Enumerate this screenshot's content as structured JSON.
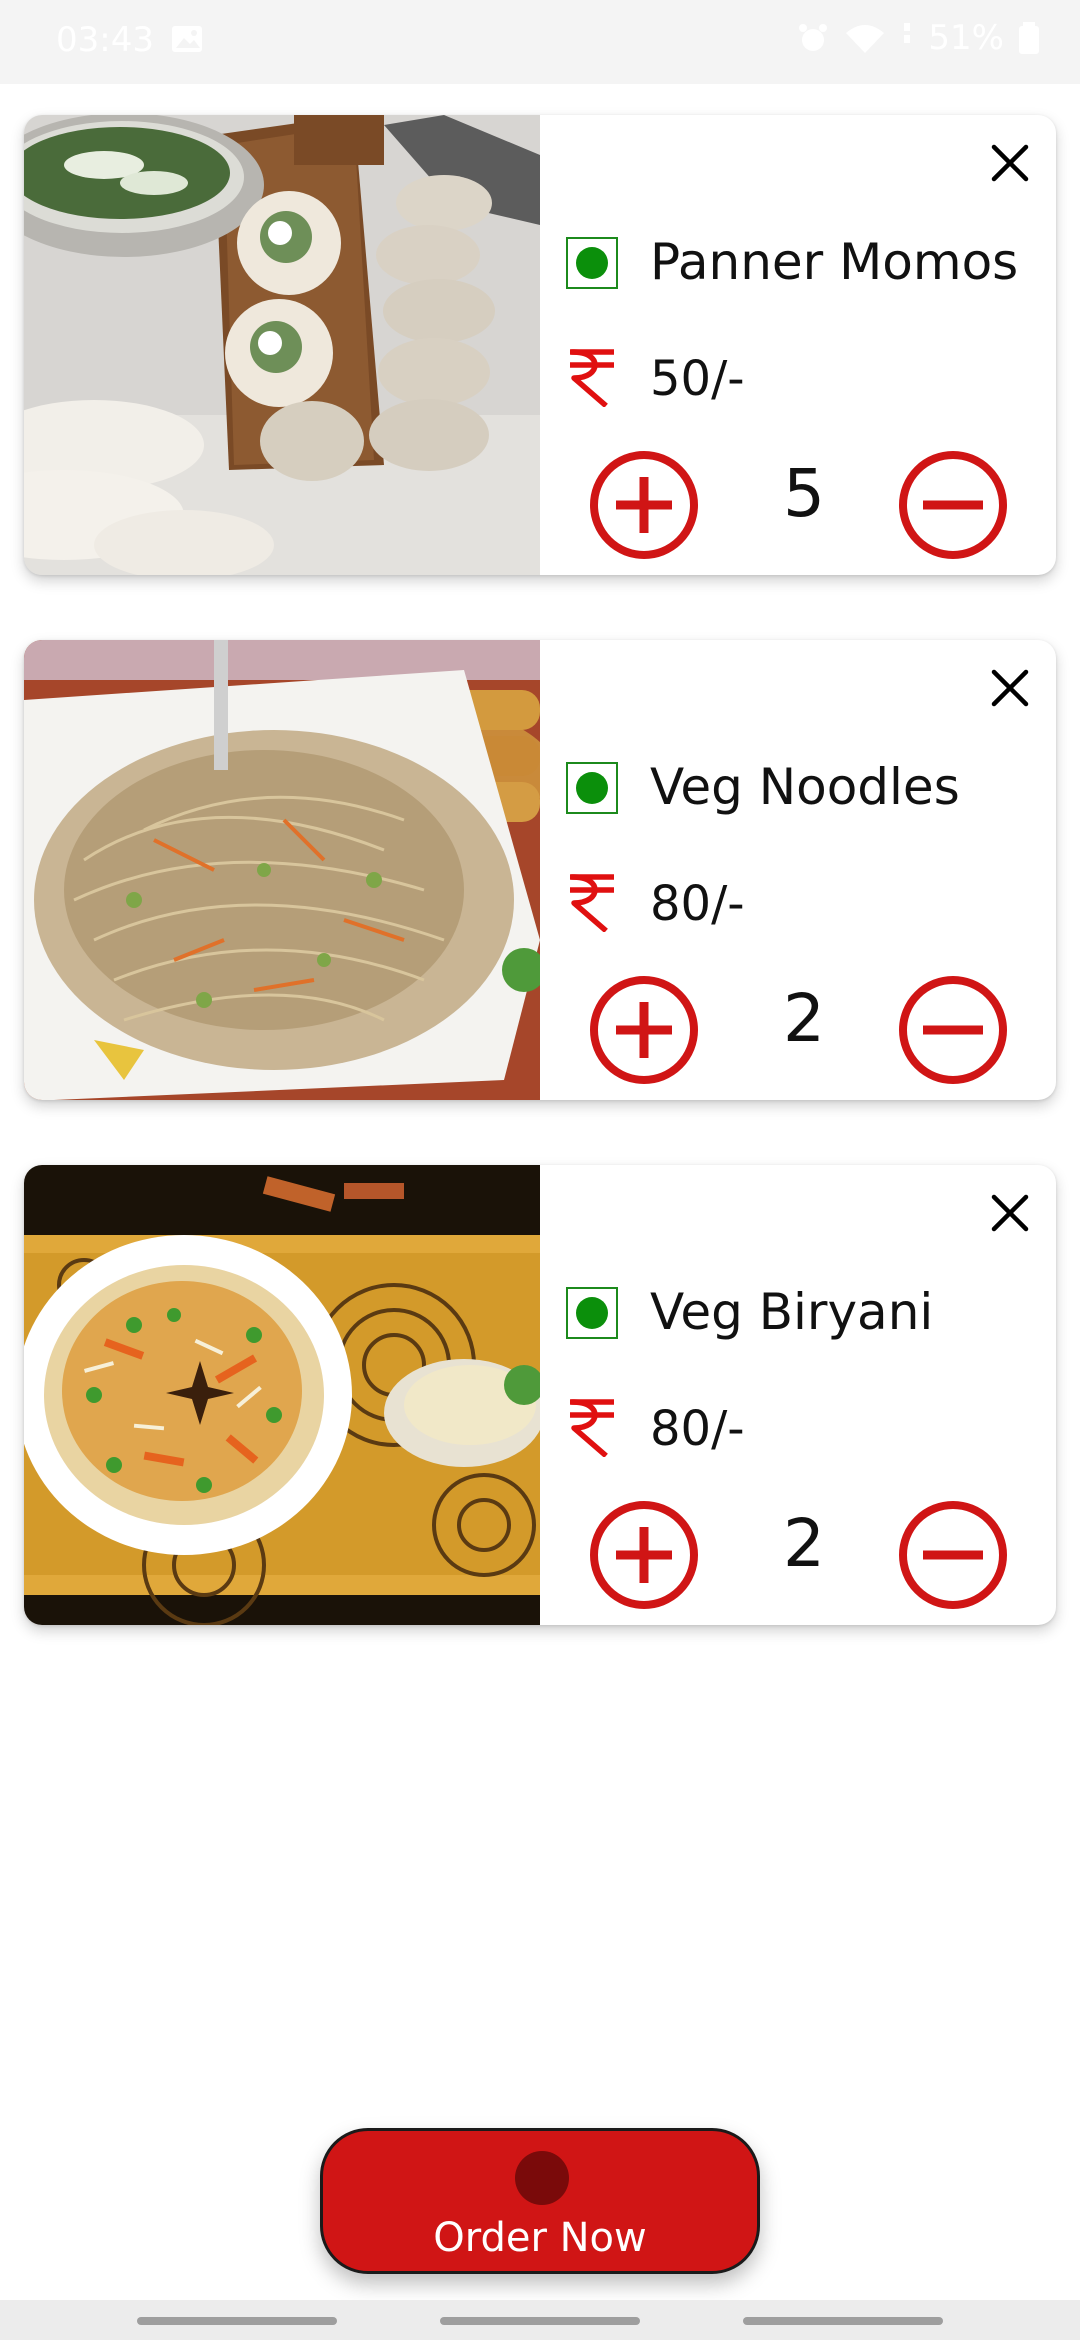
{
  "status_bar": {
    "time": "03:43",
    "battery": "51%"
  },
  "cart": {
    "items": [
      {
        "name": "Panner Momos",
        "price": "50/-",
        "quantity": "5",
        "veg": true
      },
      {
        "name": "Veg Noodles",
        "price": "80/-",
        "quantity": "2",
        "veg": true
      },
      {
        "name": "Veg Biryani",
        "price": "80/-",
        "quantity": "2",
        "veg": true
      }
    ]
  },
  "order_button": {
    "label": "Order Now"
  },
  "colors": {
    "accent_red": "#d01515",
    "veg_green": "#0b8f0b",
    "text": "#111111"
  },
  "icons": {
    "close": "close-icon",
    "rupee": "rupee-icon",
    "plus": "plus-circle-icon",
    "minus": "minus-circle-icon",
    "veg": "veg-indicator-icon"
  }
}
